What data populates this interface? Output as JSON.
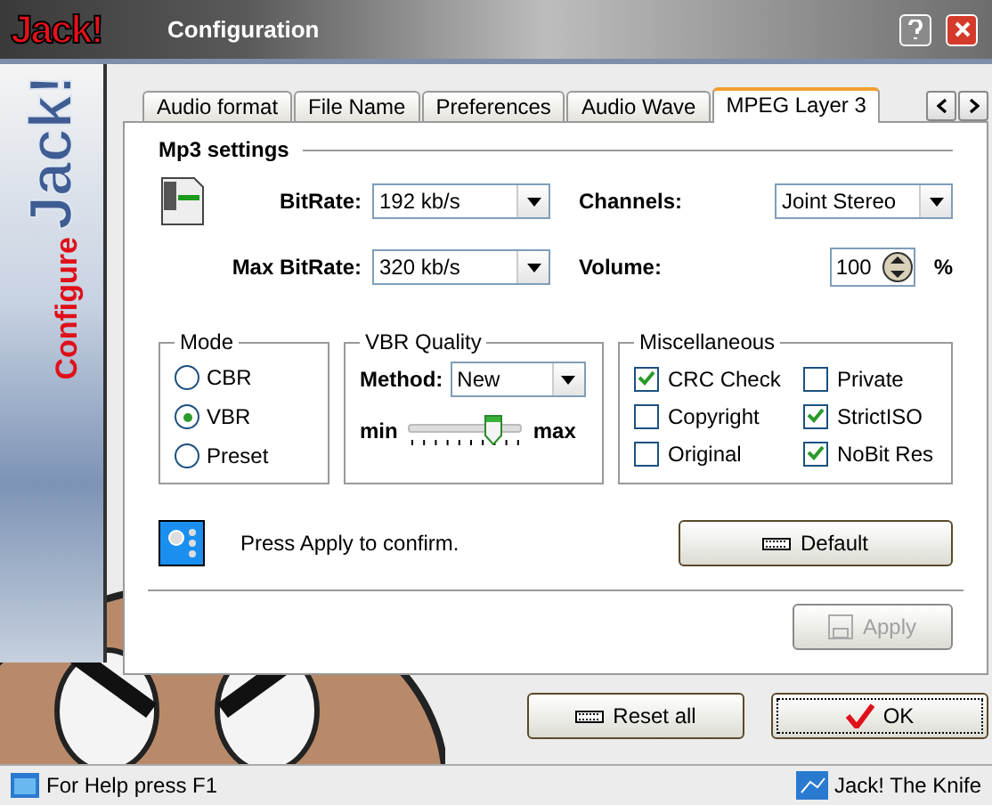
{
  "window": {
    "title": "Configuration",
    "logo": "Jack!"
  },
  "banner": {
    "logo": "Jack!",
    "caption": "Configure"
  },
  "tabs": [
    {
      "label": "Audio format",
      "selected": false
    },
    {
      "label": "File Name",
      "selected": false
    },
    {
      "label": "Preferences",
      "selected": false
    },
    {
      "label": "Audio Wave",
      "selected": false
    },
    {
      "label": "MPEG Layer 3",
      "selected": true
    }
  ],
  "mp3_settings": {
    "title": "Mp3 settings",
    "bitrate": {
      "label": "BitRate:",
      "value": "192 kb/s"
    },
    "max_bitrate": {
      "label": "Max BitRate:",
      "value": "320 kb/s"
    },
    "channels": {
      "label": "Channels:",
      "value": "Joint Stereo"
    },
    "volume": {
      "label": "Volume:",
      "value": "100",
      "unit": "%"
    }
  },
  "mode": {
    "title": "Mode",
    "options": [
      {
        "label": "CBR",
        "selected": false
      },
      {
        "label": "VBR",
        "selected": true
      },
      {
        "label": "Preset",
        "selected": false
      }
    ]
  },
  "vbr_quality": {
    "title": "VBR Quality",
    "method_label": "Method:",
    "method_value": "New",
    "min_label": "min",
    "max_label": "max",
    "level": 0.75
  },
  "miscellaneous": {
    "title": "Miscellaneous",
    "options": [
      {
        "label": "CRC Check",
        "checked": true
      },
      {
        "label": "Private",
        "checked": false
      },
      {
        "label": "Copyright",
        "checked": false
      },
      {
        "label": "StrictISO",
        "checked": true
      },
      {
        "label": "Original",
        "checked": false
      },
      {
        "label": "NoBit Res",
        "checked": true
      }
    ]
  },
  "hint": "Press Apply to confirm.",
  "default_button": {
    "label": "Default",
    "disabled": false
  },
  "apply_button": {
    "label": "Apply",
    "disabled": true
  },
  "reset_button": {
    "label": "Reset all",
    "disabled": false
  },
  "ok_button": {
    "label": "OK",
    "disabled": false
  },
  "status_bar": {
    "help": "For Help press F1",
    "app": "Jack! The Knife"
  }
}
